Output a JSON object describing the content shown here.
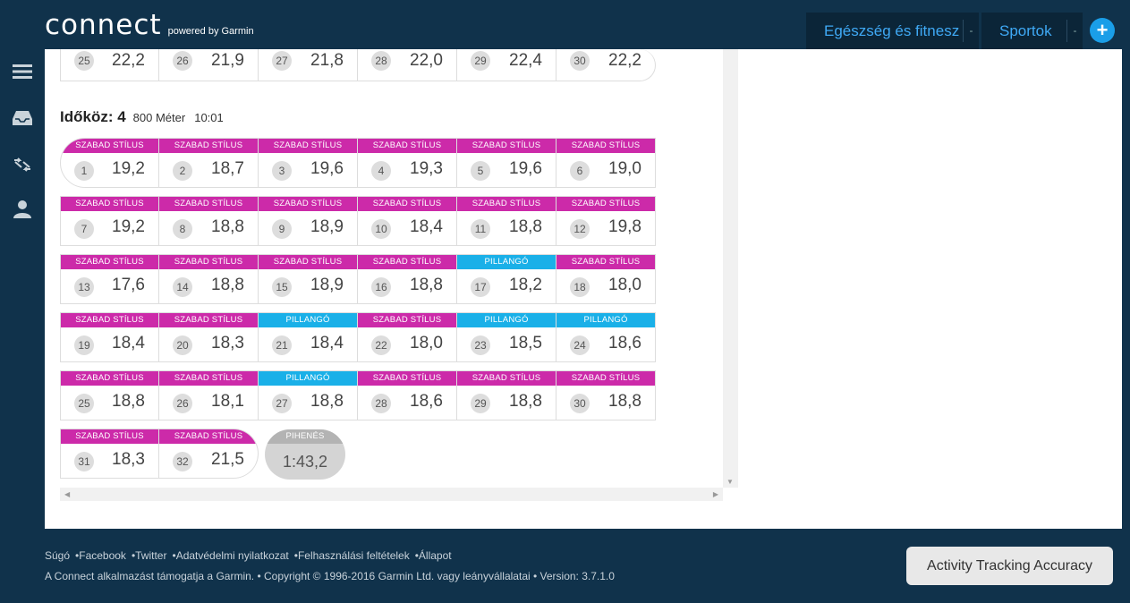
{
  "header": {
    "logo_main": "connect",
    "logo_sub": "powered by Garmin",
    "nav_health": "Egészség és fitnesz",
    "nav_sports": "Sportok",
    "nav_sep": "-",
    "plus": "+"
  },
  "sidebar": {
    "icons": [
      "menu-icon",
      "inbox-icon",
      "arrows-icon",
      "user-icon"
    ]
  },
  "prev_row": [
    {
      "n": "25",
      "v": "22,2"
    },
    {
      "n": "26",
      "v": "21,9"
    },
    {
      "n": "27",
      "v": "21,8"
    },
    {
      "n": "28",
      "v": "22,0"
    },
    {
      "n": "29",
      "v": "22,4"
    },
    {
      "n": "30",
      "v": "22,2"
    }
  ],
  "interval": {
    "title": "Időköz: 4",
    "distance": "800 Méter",
    "time": "10:01"
  },
  "labels": {
    "free": "SZABAD STÍLUS",
    "fly": "PILLANGÓ",
    "rest": "PIHENÉS"
  },
  "laps": [
    [
      {
        "n": "1",
        "v": "19,2",
        "t": "free"
      },
      {
        "n": "2",
        "v": "18,7",
        "t": "free"
      },
      {
        "n": "3",
        "v": "19,6",
        "t": "free"
      },
      {
        "n": "4",
        "v": "19,3",
        "t": "free"
      },
      {
        "n": "5",
        "v": "19,6",
        "t": "free"
      },
      {
        "n": "6",
        "v": "19,0",
        "t": "free"
      }
    ],
    [
      {
        "n": "7",
        "v": "19,2",
        "t": "free"
      },
      {
        "n": "8",
        "v": "18,8",
        "t": "free"
      },
      {
        "n": "9",
        "v": "18,9",
        "t": "free"
      },
      {
        "n": "10",
        "v": "18,4",
        "t": "free"
      },
      {
        "n": "11",
        "v": "18,8",
        "t": "free"
      },
      {
        "n": "12",
        "v": "19,8",
        "t": "free"
      }
    ],
    [
      {
        "n": "13",
        "v": "17,6",
        "t": "free"
      },
      {
        "n": "14",
        "v": "18,8",
        "t": "free"
      },
      {
        "n": "15",
        "v": "18,9",
        "t": "free"
      },
      {
        "n": "16",
        "v": "18,8",
        "t": "free"
      },
      {
        "n": "17",
        "v": "18,2",
        "t": "fly"
      },
      {
        "n": "18",
        "v": "18,0",
        "t": "free"
      }
    ],
    [
      {
        "n": "19",
        "v": "18,4",
        "t": "free"
      },
      {
        "n": "20",
        "v": "18,3",
        "t": "free"
      },
      {
        "n": "21",
        "v": "18,4",
        "t": "fly"
      },
      {
        "n": "22",
        "v": "18,0",
        "t": "free"
      },
      {
        "n": "23",
        "v": "18,5",
        "t": "fly"
      },
      {
        "n": "24",
        "v": "18,6",
        "t": "fly"
      }
    ],
    [
      {
        "n": "25",
        "v": "18,8",
        "t": "free"
      },
      {
        "n": "26",
        "v": "18,1",
        "t": "free"
      },
      {
        "n": "27",
        "v": "18,8",
        "t": "fly"
      },
      {
        "n": "28",
        "v": "18,6",
        "t": "free"
      },
      {
        "n": "29",
        "v": "18,8",
        "t": "free"
      },
      {
        "n": "30",
        "v": "18,8",
        "t": "free"
      }
    ],
    [
      {
        "n": "31",
        "v": "18,3",
        "t": "free"
      },
      {
        "n": "32",
        "v": "21,5",
        "t": "free"
      }
    ]
  ],
  "rest": {
    "label": "PIHENÉS",
    "value": "1:43,2"
  },
  "colors": {
    "free": "#cc2aa9",
    "fly": "#1ab0e8",
    "accent": "#3fa9f5",
    "bg": "#10324b"
  },
  "footer": {
    "links": [
      "Súgó",
      "Facebook",
      "Twitter",
      "Adatvédelmi nyilatkozat",
      "Felhasználási feltételek",
      "Állapot"
    ],
    "dot": "•",
    "copyright": "A Connect alkalmazást támogatja a Garmin. • Copyright © 1996-2016 Garmin Ltd. vagy leányvállalatai • Version: 3.7.1.0",
    "ata_button": "Activity Tracking Accuracy"
  }
}
